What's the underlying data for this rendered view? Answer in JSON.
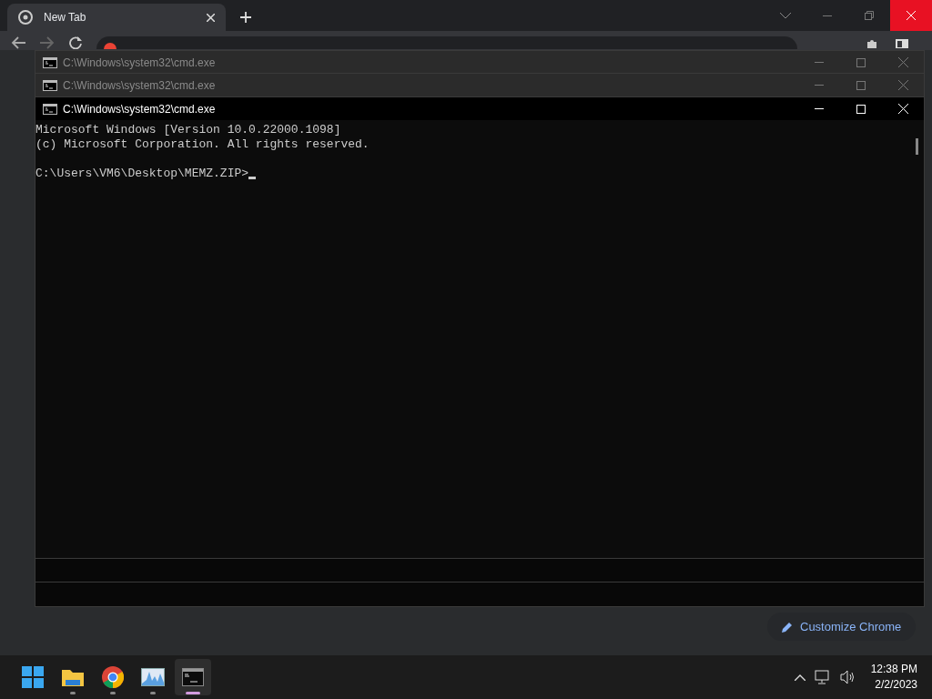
{
  "browser": {
    "tab": {
      "title": "New Tab"
    },
    "close_hovered": true,
    "customize_button": "Customize Chrome"
  },
  "windows": [
    {
      "title": "C:\\Windows\\system32\\cmd.exe",
      "active": false
    },
    {
      "title": "C:\\Windows\\system32\\cmd.exe",
      "active": false
    },
    {
      "title": "C:\\Windows\\system32\\cmd.exe",
      "active": true
    }
  ],
  "console": {
    "lines": [
      {
        "kind": "output",
        "text": "Microsoft Windows [Version 10.0.22000.1098]"
      },
      {
        "kind": "output",
        "text": "(c) Microsoft Corporation. All rights reserved."
      },
      {
        "kind": "blank"
      },
      {
        "kind": "prompt",
        "text": "C:\\Users\\VM6\\Desktop\\MEMZ.ZIP>"
      }
    ]
  },
  "taskbar": {
    "apps": [
      {
        "kind": "start",
        "selected": false
      },
      {
        "kind": "explorer",
        "selected": false
      },
      {
        "kind": "chrome",
        "selected": false
      },
      {
        "kind": "monitor",
        "selected": false
      },
      {
        "kind": "terminal",
        "selected": true
      }
    ],
    "time": "12:38 PM",
    "date": "2/2/2023"
  }
}
